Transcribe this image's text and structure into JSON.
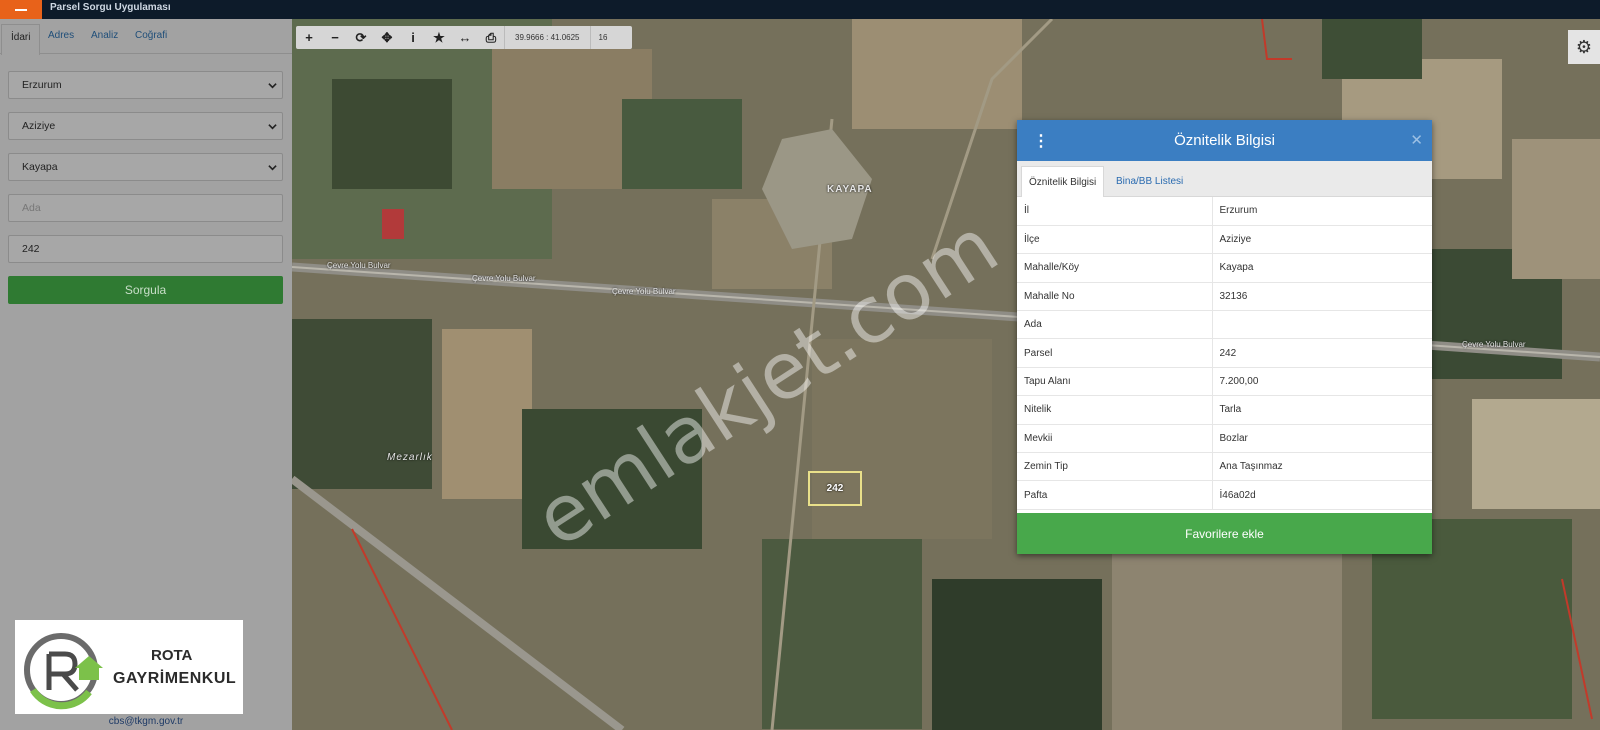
{
  "app": {
    "title": "Parsel Sorgu Uygulaması",
    "menu_icon": "hamburger-icon",
    "accent": "#e8621a"
  },
  "sidebar": {
    "tabs": [
      {
        "label": "İdari",
        "active": true
      },
      {
        "label": "Adres"
      },
      {
        "label": "Analiz"
      },
      {
        "label": "Coğrafi"
      }
    ],
    "province": "Erzurum",
    "district": "Aziziye",
    "neighborhood": "Kayapa",
    "ada_placeholder": "Ada",
    "parcel_value": "242",
    "query_button": "Sorgula",
    "email": "cbs@tkgm.gov.tr"
  },
  "logo": {
    "line1": "ROTA",
    "line2": "GAYRİMENKUL"
  },
  "map": {
    "toolbar": {
      "icons": [
        "zoom-in-icon",
        "zoom-out-icon",
        "refresh-icon",
        "locate-icon",
        "info-icon",
        "star-icon",
        "measure-icon",
        "print-icon"
      ],
      "glyphs": [
        "+",
        "−",
        "⟳",
        "✥",
        "i",
        "★",
        "↔",
        "⎙"
      ],
      "coords": "39.9666 : 41.0625",
      "zoom": "16"
    },
    "labels": {
      "village": "KAYAPA",
      "cemetery": "Mezarlık",
      "road1": "Çevre Yolu Bulvar",
      "road2": "Çevre Yolu Bulvar",
      "road3": "Çevre Yolu Bulvar",
      "road4": "Çevre Yolu Bulvar"
    },
    "parcel_label": "242",
    "watermark": "emlakjet.com",
    "settings_icon": "gear-icon"
  },
  "dialog": {
    "title": "Öznitelik Bilgisi",
    "tabs": [
      "Öznitelik Bilgisi",
      "Bina/BB Listesi"
    ],
    "rows": [
      {
        "key": "İl",
        "value": "Erzurum"
      },
      {
        "key": "İlçe",
        "value": "Aziziye"
      },
      {
        "key": "Mahalle/Köy",
        "value": "Kayapa"
      },
      {
        "key": "Mahalle No",
        "value": "32136"
      },
      {
        "key": "Ada",
        "value": ""
      },
      {
        "key": "Parsel",
        "value": "242"
      },
      {
        "key": "Tapu Alanı",
        "value": "7.200,00"
      },
      {
        "key": "Nitelik",
        "value": "Tarla"
      },
      {
        "key": "Mevkii",
        "value": "Bozlar"
      },
      {
        "key": "Zemin Tip",
        "value": "Ana Taşınmaz"
      },
      {
        "key": "Pafta",
        "value": "İ46a02d"
      }
    ],
    "favorite_button": "Favorilere ekle",
    "header_color": "#3b7ec2",
    "button_color": "#48a84b"
  }
}
